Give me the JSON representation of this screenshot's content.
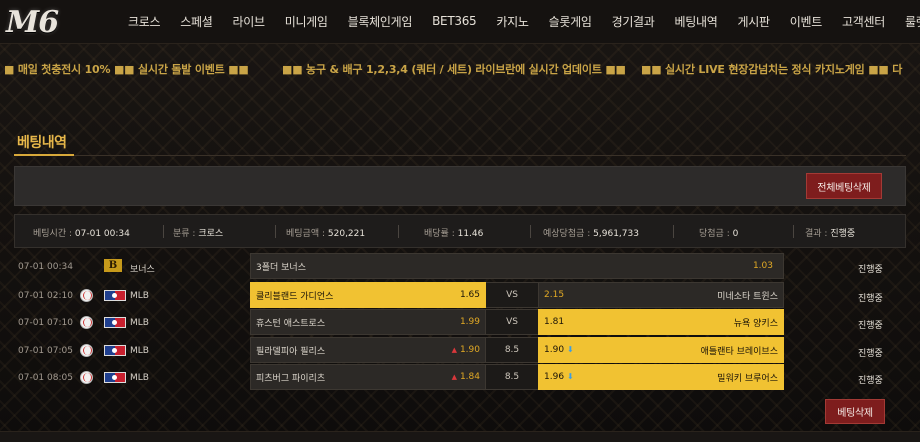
{
  "logo": "M6",
  "nav": [
    "크로스",
    "스페셜",
    "라이브",
    "미니게임",
    "블록체인게임",
    "BET365",
    "카지노",
    "슬롯게임",
    "경기결과",
    "베팅내역",
    "게시판",
    "이벤트",
    "고객센터",
    "룰렛"
  ],
  "ticker": [
    "■ 매일 첫충전시 10% ■■ 실시간 돌발 이벤트 ■■",
    "■■ 농구 & 배구 1,2,3,4 (쿼터 / 세트) 라이브란에 실시간 업데이트 ■■",
    "■■ 실시간 LIVE 현장감넘치는 정식 카지노게임 ■■ 다"
  ],
  "page_title": "베팅내역",
  "buttons": {
    "delete_all": "전체베팅삭제",
    "delete_bet": "베팅삭제"
  },
  "summary": {
    "bet_time_label": "베팅시간 :",
    "bet_time": "07-01 00:34",
    "type_label": "분류 :",
    "type": "크로스",
    "amount_label": "베팅금액 :",
    "amount": "520,221",
    "rate_label": "배당률 :",
    "rate": "11.46",
    "expected_label": "예상당첨금 :",
    "expected": "5,961,733",
    "win_label": "당첨금 :",
    "win": "0",
    "result_label": "결과 :",
    "result": "진행중"
  },
  "rows": [
    {
      "date": "07-01 00:34",
      "league": "보너스",
      "status": "진행중",
      "bonus_label": "3폴더 보너스",
      "bonus_odds": "1.03"
    },
    {
      "date": "07-01 02:10",
      "league": "MLB",
      "status": "진행중",
      "home": "클리블랜드 가디언스",
      "home_odds": "1.65",
      "mid": "VS",
      "away_odds": "2.15",
      "away": "미네소타 트윈스"
    },
    {
      "date": "07-01 07:10",
      "league": "MLB",
      "status": "진행중",
      "home": "휴스턴 애스트로스",
      "home_odds": "1.99",
      "mid": "VS",
      "away_odds": "1.81",
      "away": "뉴욕 양키스"
    },
    {
      "date": "07-01 07:05",
      "league": "MLB",
      "status": "진행중",
      "home": "필라델피아 필리스",
      "home_odds": "1.90",
      "mid": "8.5",
      "away_odds": "1.90",
      "away": "애틀랜타 브레이브스"
    },
    {
      "date": "07-01 08:05",
      "league": "MLB",
      "status": "진행중",
      "home": "피츠버그 파이리츠",
      "home_odds": "1.84",
      "mid": "8.5",
      "away_odds": "1.96",
      "away": "밀워키 브루어스"
    }
  ]
}
